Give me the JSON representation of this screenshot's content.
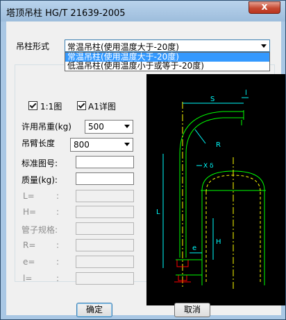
{
  "window": {
    "title": "塔顶吊柱 HG/T 21639-2005",
    "close_label": "x"
  },
  "type_label": "吊柱形式",
  "type_combo": {
    "value": "常温吊柱(使用温度大于-20度)",
    "options": [
      "常温吊柱(使用温度大于-20度)",
      "低温吊柱(使用温度小于或等于-20度)"
    ]
  },
  "checkbox_scale": {
    "label": "1:1图",
    "checked": true
  },
  "checkbox_detail": {
    "label": "A1详图",
    "checked": true
  },
  "fields": {
    "allowed_load": {
      "label": "许用吊重(kg)",
      "value": "500"
    },
    "arm_length": {
      "label": "吊臂长度",
      "value": "800"
    },
    "std_drawing_no": {
      "label": "标准图号:",
      "value": ""
    },
    "mass": {
      "label": "质量(kg):",
      "value": ""
    },
    "L": {
      "label": "L=",
      "colon": ":",
      "value": ""
    },
    "H": {
      "label": "H=",
      "colon": ":",
      "value": ""
    },
    "pipe_spec": {
      "label": "管子规格:",
      "value": ""
    },
    "R": {
      "label": "R=",
      "colon": ":",
      "value": ""
    },
    "e": {
      "label": "e=",
      "colon": ":",
      "value": ""
    },
    "l": {
      "label": "l=",
      "colon": ":",
      "value": ""
    }
  },
  "drawing": {
    "S": "S",
    "l": "l",
    "R": "R",
    "Xd": "X δ",
    "L": "L",
    "H": "H",
    "e": "e"
  },
  "buttons": {
    "ok": "确定",
    "cancel": "取消"
  },
  "colors": {
    "titlebar": "#a9c7e4",
    "selection": "#3399ff",
    "drawing_bg": "#000000",
    "cyan": "#00ffff",
    "green": "#00ff00",
    "red": "#ff0000",
    "yellow": "#ffff00"
  }
}
